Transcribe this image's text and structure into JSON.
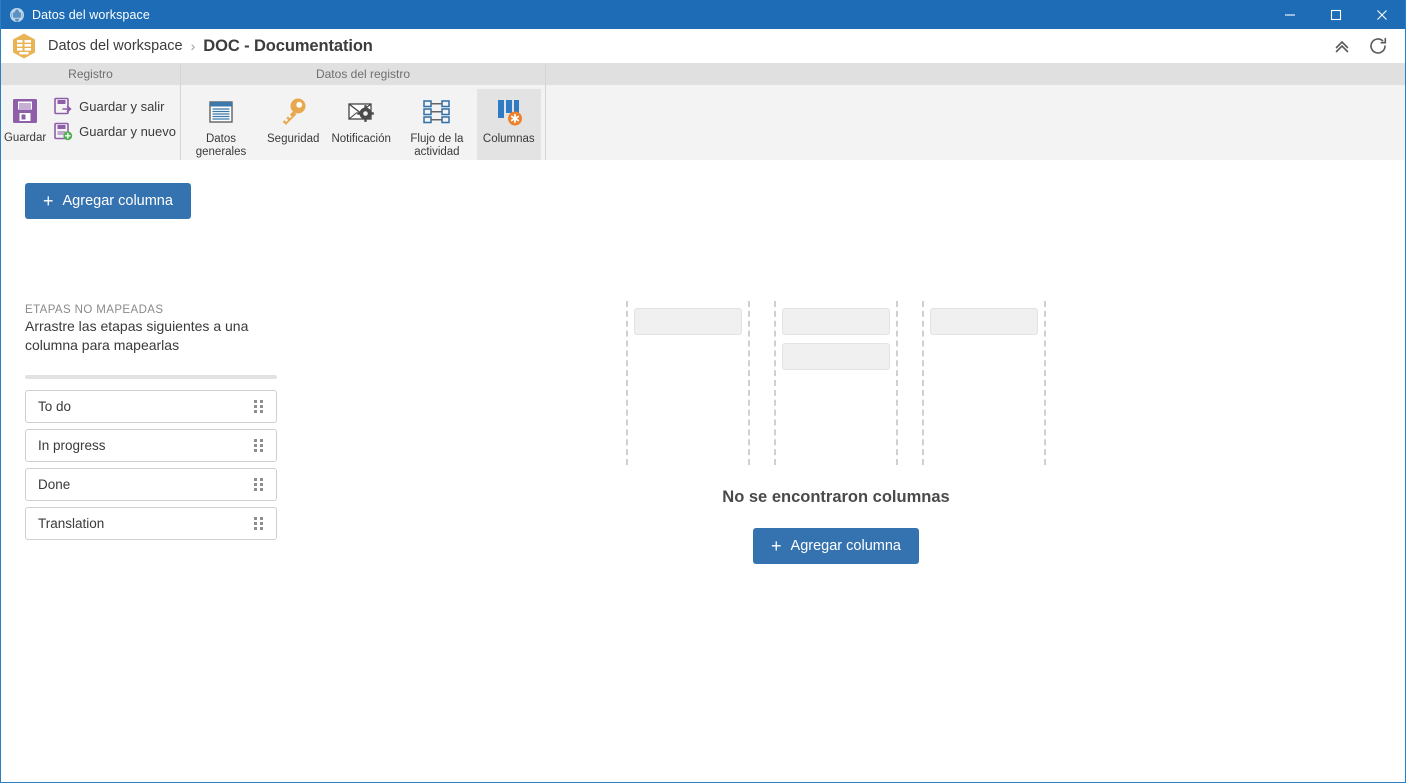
{
  "window": {
    "title": "Datos del workspace",
    "icon": "globe-icon",
    "controls": {
      "minimize": "minimize-icon",
      "maximize": "maximize-icon",
      "close": "close-icon"
    }
  },
  "breadcrumb": {
    "app_icon": "workspace-data-hex-icon",
    "root": "Datos del workspace",
    "separator": "›",
    "current": "DOC - Documentation",
    "actions": {
      "collapse": "collapse-ribbon-icon",
      "refresh": "refresh-icon"
    }
  },
  "ribbon": {
    "groups": [
      {
        "id": "registro",
        "header": "Registro",
        "big_button": {
          "label": "Guardar",
          "icon": "save-floppy-icon"
        },
        "small_buttons": [
          {
            "label": "Guardar y salir",
            "icon": "save-and-exit-icon"
          },
          {
            "label": "Guardar y nuevo",
            "icon": "save-and-new-icon"
          }
        ]
      },
      {
        "id": "datos-del-registro",
        "header": "Datos del registro",
        "tabs": [
          {
            "label": "Datos generales",
            "icon": "document-icon",
            "active": false
          },
          {
            "label": "Seguridad",
            "icon": "key-icon",
            "active": false
          },
          {
            "label": "Notificación",
            "icon": "envelope-gear-icon",
            "active": false
          },
          {
            "label": "Flujo de la actividad",
            "icon": "workflow-icon",
            "active": false
          },
          {
            "label": "Columnas",
            "icon": "columns-icon",
            "active": true
          }
        ]
      }
    ]
  },
  "main": {
    "add_column_button": {
      "label": "Agregar columna",
      "plus": "+"
    },
    "unmapped": {
      "title": "ETAPAS NO MAPEADAS",
      "description": "Arrastre las etapas siguientes a una columna para mapearlas",
      "stages": [
        {
          "name": "To do",
          "handle": "drag-handle-icon"
        },
        {
          "name": "In progress",
          "handle": "drag-handle-icon"
        },
        {
          "name": "Done",
          "handle": "drag-handle-icon"
        },
        {
          "name": "Translation",
          "handle": "drag-handle-icon"
        }
      ]
    },
    "empty_state": {
      "message": "No se encontraron columnas",
      "add_column_button": {
        "label": "Agregar columna",
        "plus": "+"
      },
      "ghost_columns": [
        {
          "cards": 1
        },
        {
          "cards": 2
        },
        {
          "cards": 1
        }
      ]
    }
  },
  "colors": {
    "titlebar": "#1d6cb5",
    "accent_blue": "#3572b0",
    "ribbon_bg": "#f3f3f3",
    "group_header_bg": "#e0e0e0",
    "active_tab_bg": "#e3e3e3",
    "save_icon_purple": "#8e5ea8",
    "key_icon_orange": "#e8a94e",
    "columns_badge_orange": "#f0802a"
  }
}
